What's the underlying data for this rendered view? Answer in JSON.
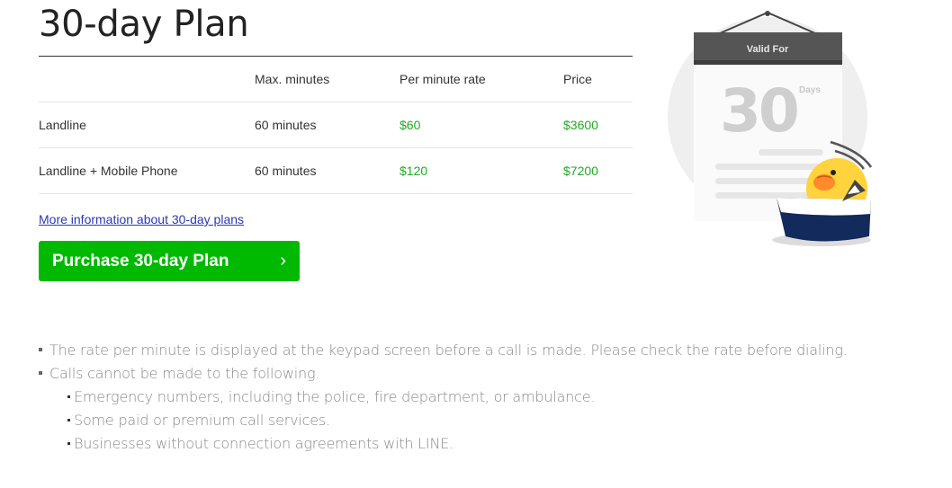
{
  "page": {
    "title": "30-day Plan",
    "more_link": "More information about 30-day plans",
    "purchase_button": "Purchase 30-day Plan"
  },
  "table": {
    "headers": [
      "",
      "Max. minutes",
      "Per minute rate",
      "Price"
    ],
    "rows": [
      {
        "type": "Landline",
        "minutes": "60 minutes",
        "rate": "$60",
        "price": "$3600"
      },
      {
        "type": "Landline + Mobile Phone",
        "minutes": "60 minutes",
        "rate": "$120",
        "price": "$7200"
      }
    ]
  },
  "notes": {
    "items": [
      "The rate per minute is displayed at the keypad screen before a call is made. Please check the rate before dialing.",
      "Calls cannot be made to the following."
    ],
    "sub_items": [
      "Emergency numbers, including the police, fire department, or ambulance.",
      "Some paid or premium call services.",
      "Businesses without connection agreements with LINE."
    ]
  },
  "illustration": {
    "calendar_header": "Valid For",
    "calendar_number": "30",
    "calendar_unit": "Days"
  },
  "colors": {
    "accent_green": "#00b900",
    "price_green": "#1faa22",
    "link_blue": "#2a37b3"
  }
}
